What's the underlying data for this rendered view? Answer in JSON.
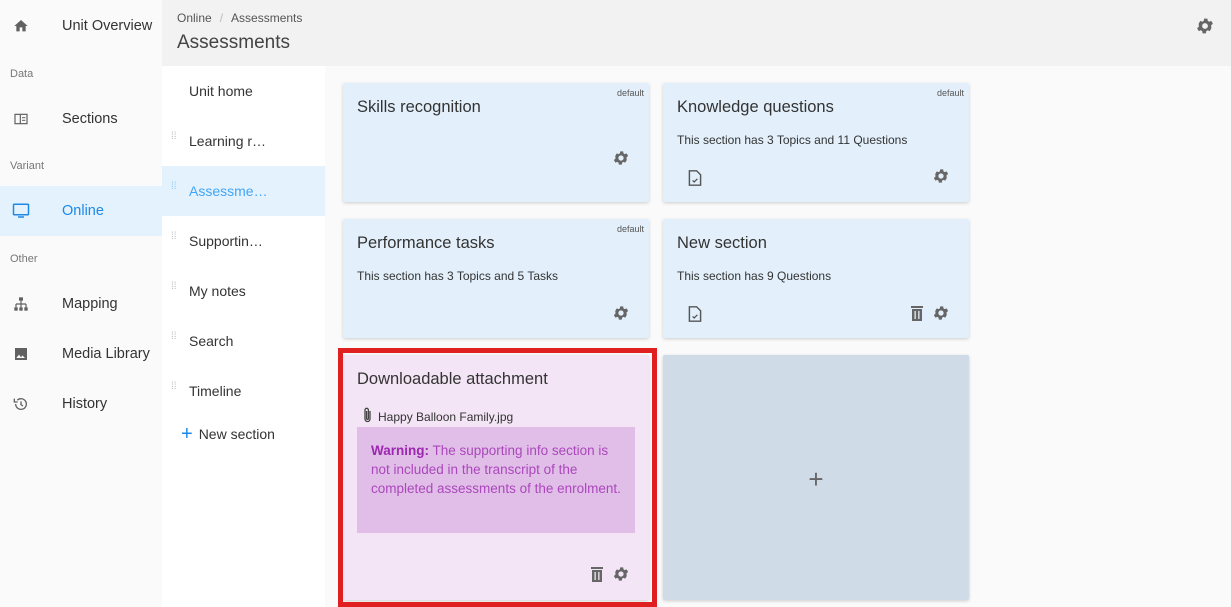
{
  "leftnav": {
    "items": [
      {
        "label": "Unit Overview",
        "icon": "home-icon"
      },
      {
        "label": "Sections",
        "icon": "sections-icon"
      },
      {
        "label": "Online",
        "icon": "monitor-icon"
      },
      {
        "label": "Mapping",
        "icon": "sitemap-icon"
      },
      {
        "label": "Media Library",
        "icon": "image-icon"
      },
      {
        "label": "History",
        "icon": "history-icon"
      }
    ],
    "groups": {
      "data": "Data",
      "variant": "Variant",
      "other": "Other"
    }
  },
  "header": {
    "breadcrumb": [
      "Online",
      "Assessments"
    ],
    "separator": "/",
    "title": "Assessments"
  },
  "subnav": {
    "items": [
      {
        "label": "Unit home"
      },
      {
        "label": "Learning r…"
      },
      {
        "label": "Assessme…"
      },
      {
        "label": "Supportin…"
      },
      {
        "label": "My notes"
      },
      {
        "label": "Search"
      },
      {
        "label": "Timeline"
      }
    ],
    "new_section": "New section"
  },
  "cards": [
    {
      "title": "Skills recognition",
      "badge": "default"
    },
    {
      "title": "Knowledge questions",
      "badge": "default",
      "desc": "This section has 3 Topics and 11 Questions"
    },
    {
      "title": "Performance tasks",
      "badge": "default",
      "desc": "This section has 3 Topics and 5 Tasks"
    },
    {
      "title": "New section",
      "desc": "This section has 9 Questions"
    },
    {
      "title": "Downloadable attachment",
      "attachment": "Happy Balloon Family.jpg",
      "warning_label": "Warning:",
      "warning_text": " The supporting info section is not included in the transcript of the completed assessments of the enrolment."
    }
  ],
  "add_card": {
    "symbol": "+"
  },
  "colors": {
    "accent": "#1e88e5",
    "card_bg": "#e3f0fb",
    "attachment_bg": "#f3e5f5",
    "warning_bg": "#e1bee7",
    "warning_text": "#ab47bc",
    "highlight": "#e02020"
  }
}
